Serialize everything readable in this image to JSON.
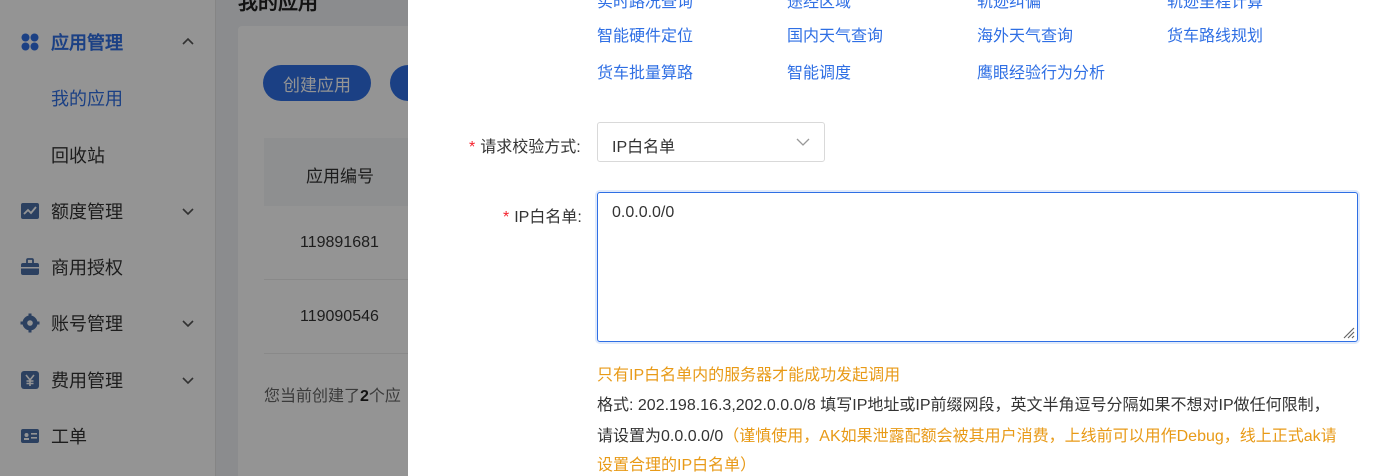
{
  "sidebar": {
    "items": [
      {
        "label": "应用管理",
        "icon": "app-grid-icon",
        "expanded": true
      },
      {
        "label": "我的应用",
        "sub": true,
        "selected": true
      },
      {
        "label": "回收站",
        "sub": true
      },
      {
        "label": "额度管理",
        "icon": "quota-chart-icon"
      },
      {
        "label": "商用授权",
        "icon": "briefcase-icon"
      },
      {
        "label": "账号管理",
        "icon": "gear-icon"
      },
      {
        "label": "费用管理",
        "icon": "yen-icon"
      },
      {
        "label": "工单",
        "icon": "ticket-card-icon"
      }
    ]
  },
  "main": {
    "title": "我的应用",
    "create_button": "创建应用",
    "table_header": "应用编号",
    "rows": [
      "119891681",
      "119090546"
    ],
    "summary_prefix": "您当前创建了",
    "summary_count": "2",
    "summary_suffix": "个应"
  },
  "drawer": {
    "services_row0": [
      "实时路况查询",
      "途经区域",
      "轨迹纠偏",
      "轨迹里程计算"
    ],
    "services_row1": [
      "智能硬件定位",
      "国内天气查询",
      "海外天气查询",
      "货车路线规划"
    ],
    "services_row2": [
      "货车批量算路",
      "智能调度",
      "鹰眼经验行为分析"
    ],
    "verify_label": "请求校验方式:",
    "verify_value": "IP白名单",
    "whitelist_label": "IP白名单:",
    "whitelist_value": "0.0.0.0/0",
    "hint_warning": "只有IP白名单内的服务器才能成功发起调用",
    "hint_line1": "格式: 202.198.16.3,202.0.0.0/8 填写IP地址或IP前缀网段，英文半角逗号分隔如果不想对IP做任何限制，",
    "hint_line2_prefix": "请设置为0.0.0.0/0",
    "hint_line2_warn": "（谨慎使用，AK如果泄露配额会被其用户消费，上线前可以用作Debug，线上正式ak请",
    "hint_line3_warn": "设置合理的IP白名单）"
  },
  "colors": {
    "primary": "#2f6fe4",
    "warning": "#e89a17",
    "required": "#f5222d"
  }
}
